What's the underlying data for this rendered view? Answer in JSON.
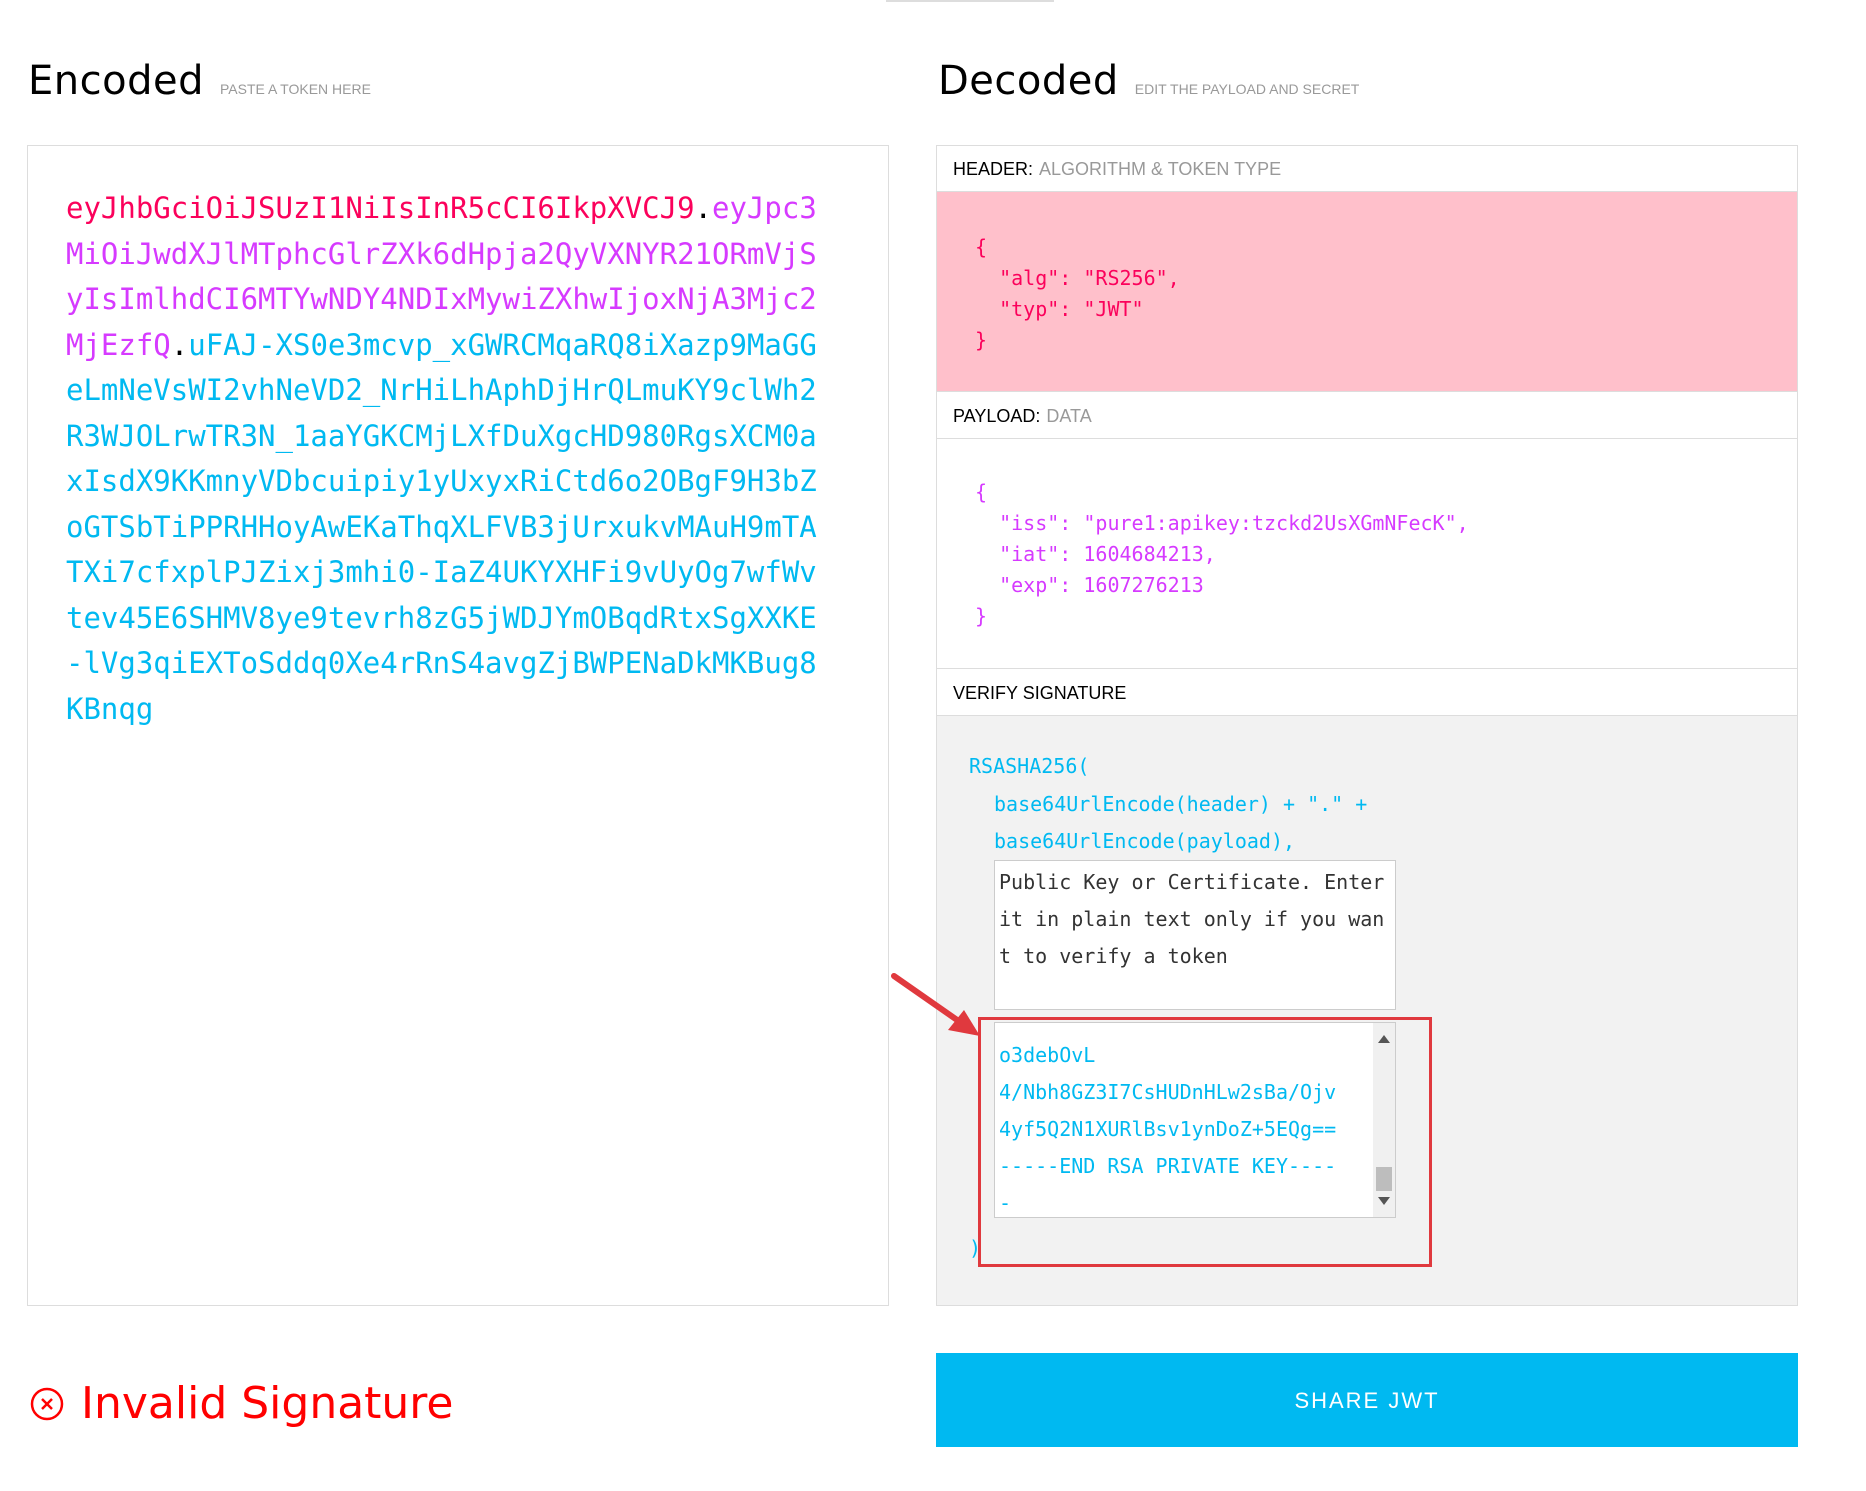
{
  "encoded": {
    "title": "Encoded",
    "hint": "PASTE A TOKEN HERE",
    "token_header": "eyJhbGciOiJSUzI1NiIsInR5cCI6IkpXVCJ9",
    "token_payload": "eyJpc3MiOiJwdXJlMTphcGlrZXk6dHpja2QyVXNYR21ORmVjSyIsImlhdCI6MTYwNDY4NDIxMywiZXhwIjoxNjA3Mjc2MjEzfQ",
    "token_signature": "uFAJ-XS0e3mcvp_xGWRCMqaRQ8iXazp9MaGGeLmNeVsWI2vhNeVD2_NrHiLhAphDjHrQLmuKY9clWh2R3WJOLrwTR3N_1aaYGKCMjLXfDuXgcHD980RgsXCM0axIsdX9KKmnyVDbcuipiy1yUxyxRiCtd6o2OBgF9H3bZoGTSbTiPPRHHoyAwEKaThqXLFVB3jUrxukvMAuH9mTATXi7cfxplPJZixj3mhi0-IaZ4UKYXHFi9vUyOg7wfWvtev45E6SHMV8ye9tevrh8zG5jWDJYmOBqdRtxSgXXKE-lVg3qiEXToSddq0Xe4rRnS4avgZjBWPENaDkMKBug8KBnqg",
    "dot": "."
  },
  "decoded": {
    "title": "Decoded",
    "hint": "EDIT THE PAYLOAD AND SECRET",
    "header_label": "HEADER:",
    "header_sub": "ALGORITHM & TOKEN TYPE",
    "header_json": "{\n  \"alg\": \"RS256\",\n  \"typ\": \"JWT\"\n}",
    "payload_label": "PAYLOAD:",
    "payload_sub": "DATA",
    "payload_json": "{\n  \"iss\": \"pure1:apikey:tzckd2UsXGmNFecK\",\n  \"iat\": 1604684213,\n  \"exp\": 1607276213\n}",
    "verify_label": "VERIFY SIGNATURE",
    "sig_fn": "RSASHA256(",
    "sig_line1": "base64UrlEncode(header) + \".\" +",
    "sig_line2": "base64UrlEncode(payload),",
    "public_key_placeholder": "Public Key or Certificate. Enter it in plain text only if you want to verify a token",
    "private_key_lines": "o3debOvL\n4/Nbh8GZ3I7CsHUDnHLw2sBa/Ojv\n4yf5Q2N1XURlBsv1ynDoZ+5EQg==\n-----END RSA PRIVATE KEY----\n-",
    "sig_close": ")"
  },
  "status": {
    "text": "Invalid Signature",
    "color": "#ff0000"
  },
  "share_button": "SHARE JWT",
  "colors": {
    "header": "#fb015b",
    "payload": "#d63aff",
    "signature": "#00b9f1",
    "header_bg": "#ffc0cb",
    "button": "#00b9f1",
    "highlight": "#e0393e"
  }
}
